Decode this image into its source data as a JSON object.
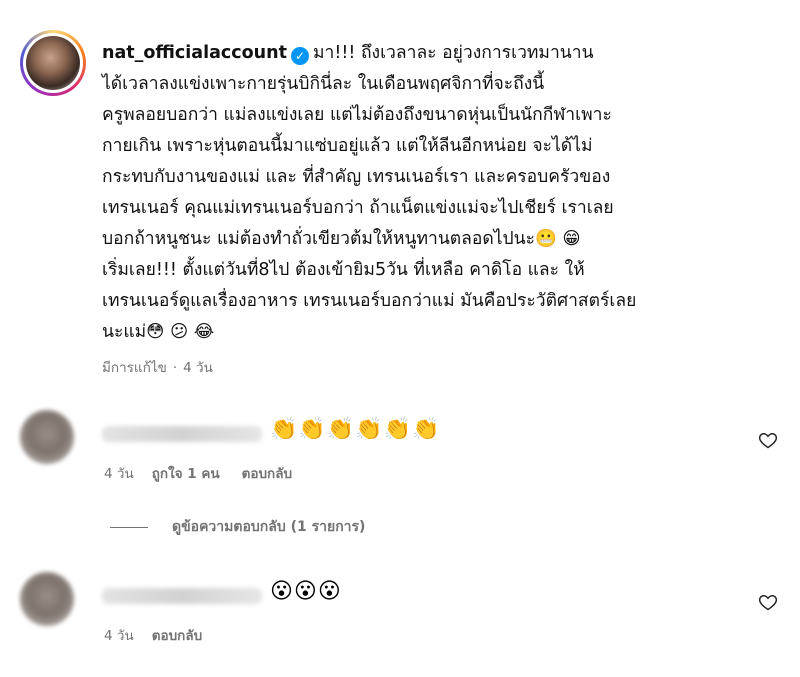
{
  "caption": {
    "username": "nat_officialaccount",
    "lines": [
      "มา!!! ถึงเวลาละ อยู่วงการเวทมานาน",
      "ได้เวลาลงแข่งเพาะกายรุ่นบิกินี่ละ ในเดือนพฤศจิกาที่จะถึงนี้",
      "ครูพลอยบอกว่า แม่ลงแข่งเลย แต่ไม่ต้องถึงขนาดหุ่นเป็นนักกีฬาเพาะ",
      "กายเกิน เพราะหุ่นตอนนี้มาแซ่บอยู่แล้ว แต่ให้ลีนอีกหน่อย จะได้ไม่",
      "กระทบกับงานของแม่ และ ที่สำคัญ เทรนเนอร์เรา และครอบครัวของ",
      "เทรนเนอร์ คุณแม่เทรนเนอร์บอกว่า ถ้าแน็ตแข่งแม่จะไปเชียร์ เราเลย",
      "บอกถ้าหนูชนะ แม่ต้องทำถั่วเขียวต้มให้หนูทานตลอดไปนะ😬 😁",
      "เริ่มเลย!!! ตั้งแต่วันที่8ไป ต้องเข้ายิม5วัน ที่เหลือ คาดิโอ และ ให้",
      "เทรนเนอร์ดูแลเรื่องอาหาร เทรนเนอร์บอกว่าแม่ มันคือประวัติศาสตร์เลย",
      "นะแม่😳 😕 😂"
    ],
    "edited_label": "มีการแก้ไข",
    "separator": "·",
    "age": "4 วัน"
  },
  "comments": [
    {
      "text": "👏👏👏👏👏👏",
      "age": "4 วัน",
      "likes": "ถูกใจ 1 คน",
      "reply": "ตอบกลับ"
    },
    {
      "text": "😮😮😮",
      "age": "4 วัน",
      "reply": "ตอบกลับ"
    }
  ],
  "view_replies": "ดูข้อความตอบกลับ (1 รายการ)",
  "icons": {
    "verified": "verified-badge-icon",
    "like": "heart-outline-icon"
  },
  "colors": {
    "verified": "#0095f6",
    "secondary_text": "#737373"
  }
}
